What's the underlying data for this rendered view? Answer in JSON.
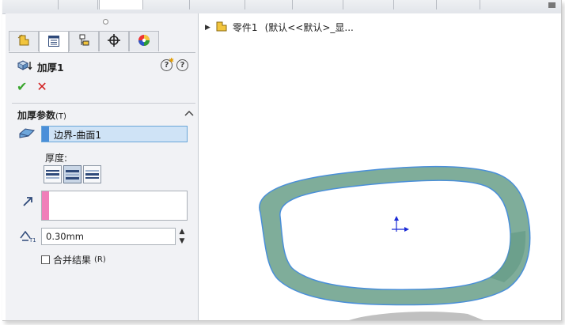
{
  "feature": {
    "title": "加厚1",
    "ok_icon": "checkmark-icon",
    "cancel_icon": "x-icon"
  },
  "tabs": [
    "feature-manager-icon",
    "property-manager-icon",
    "configuration-manager-icon",
    "dimxpert-icon",
    "display-manager-icon"
  ],
  "params_group": {
    "title": "加厚参数",
    "shortcut": "(T)",
    "face_selection": "边界-曲面1",
    "thickness_label": "厚度:",
    "thickness_options": [
      "thicken-side1",
      "thicken-both",
      "thicken-side2"
    ],
    "selected_thickness_option": 1,
    "thickness_value": "0.30mm",
    "merge_label": "合并结果",
    "merge_shortcut": "(R)",
    "merge_checked": false
  },
  "tree": {
    "part_label": "零件1",
    "config_label": "(默认<<默认>_显..."
  },
  "colors": {
    "selection_face_bar": "#4a8fd9",
    "selection_dir_bar": "#f07fb9",
    "ok_green": "#3aa62e",
    "cancel_red": "#d21f1f",
    "ring_fill": "#7fad9a",
    "ring_edge": "#4a8fd9"
  }
}
